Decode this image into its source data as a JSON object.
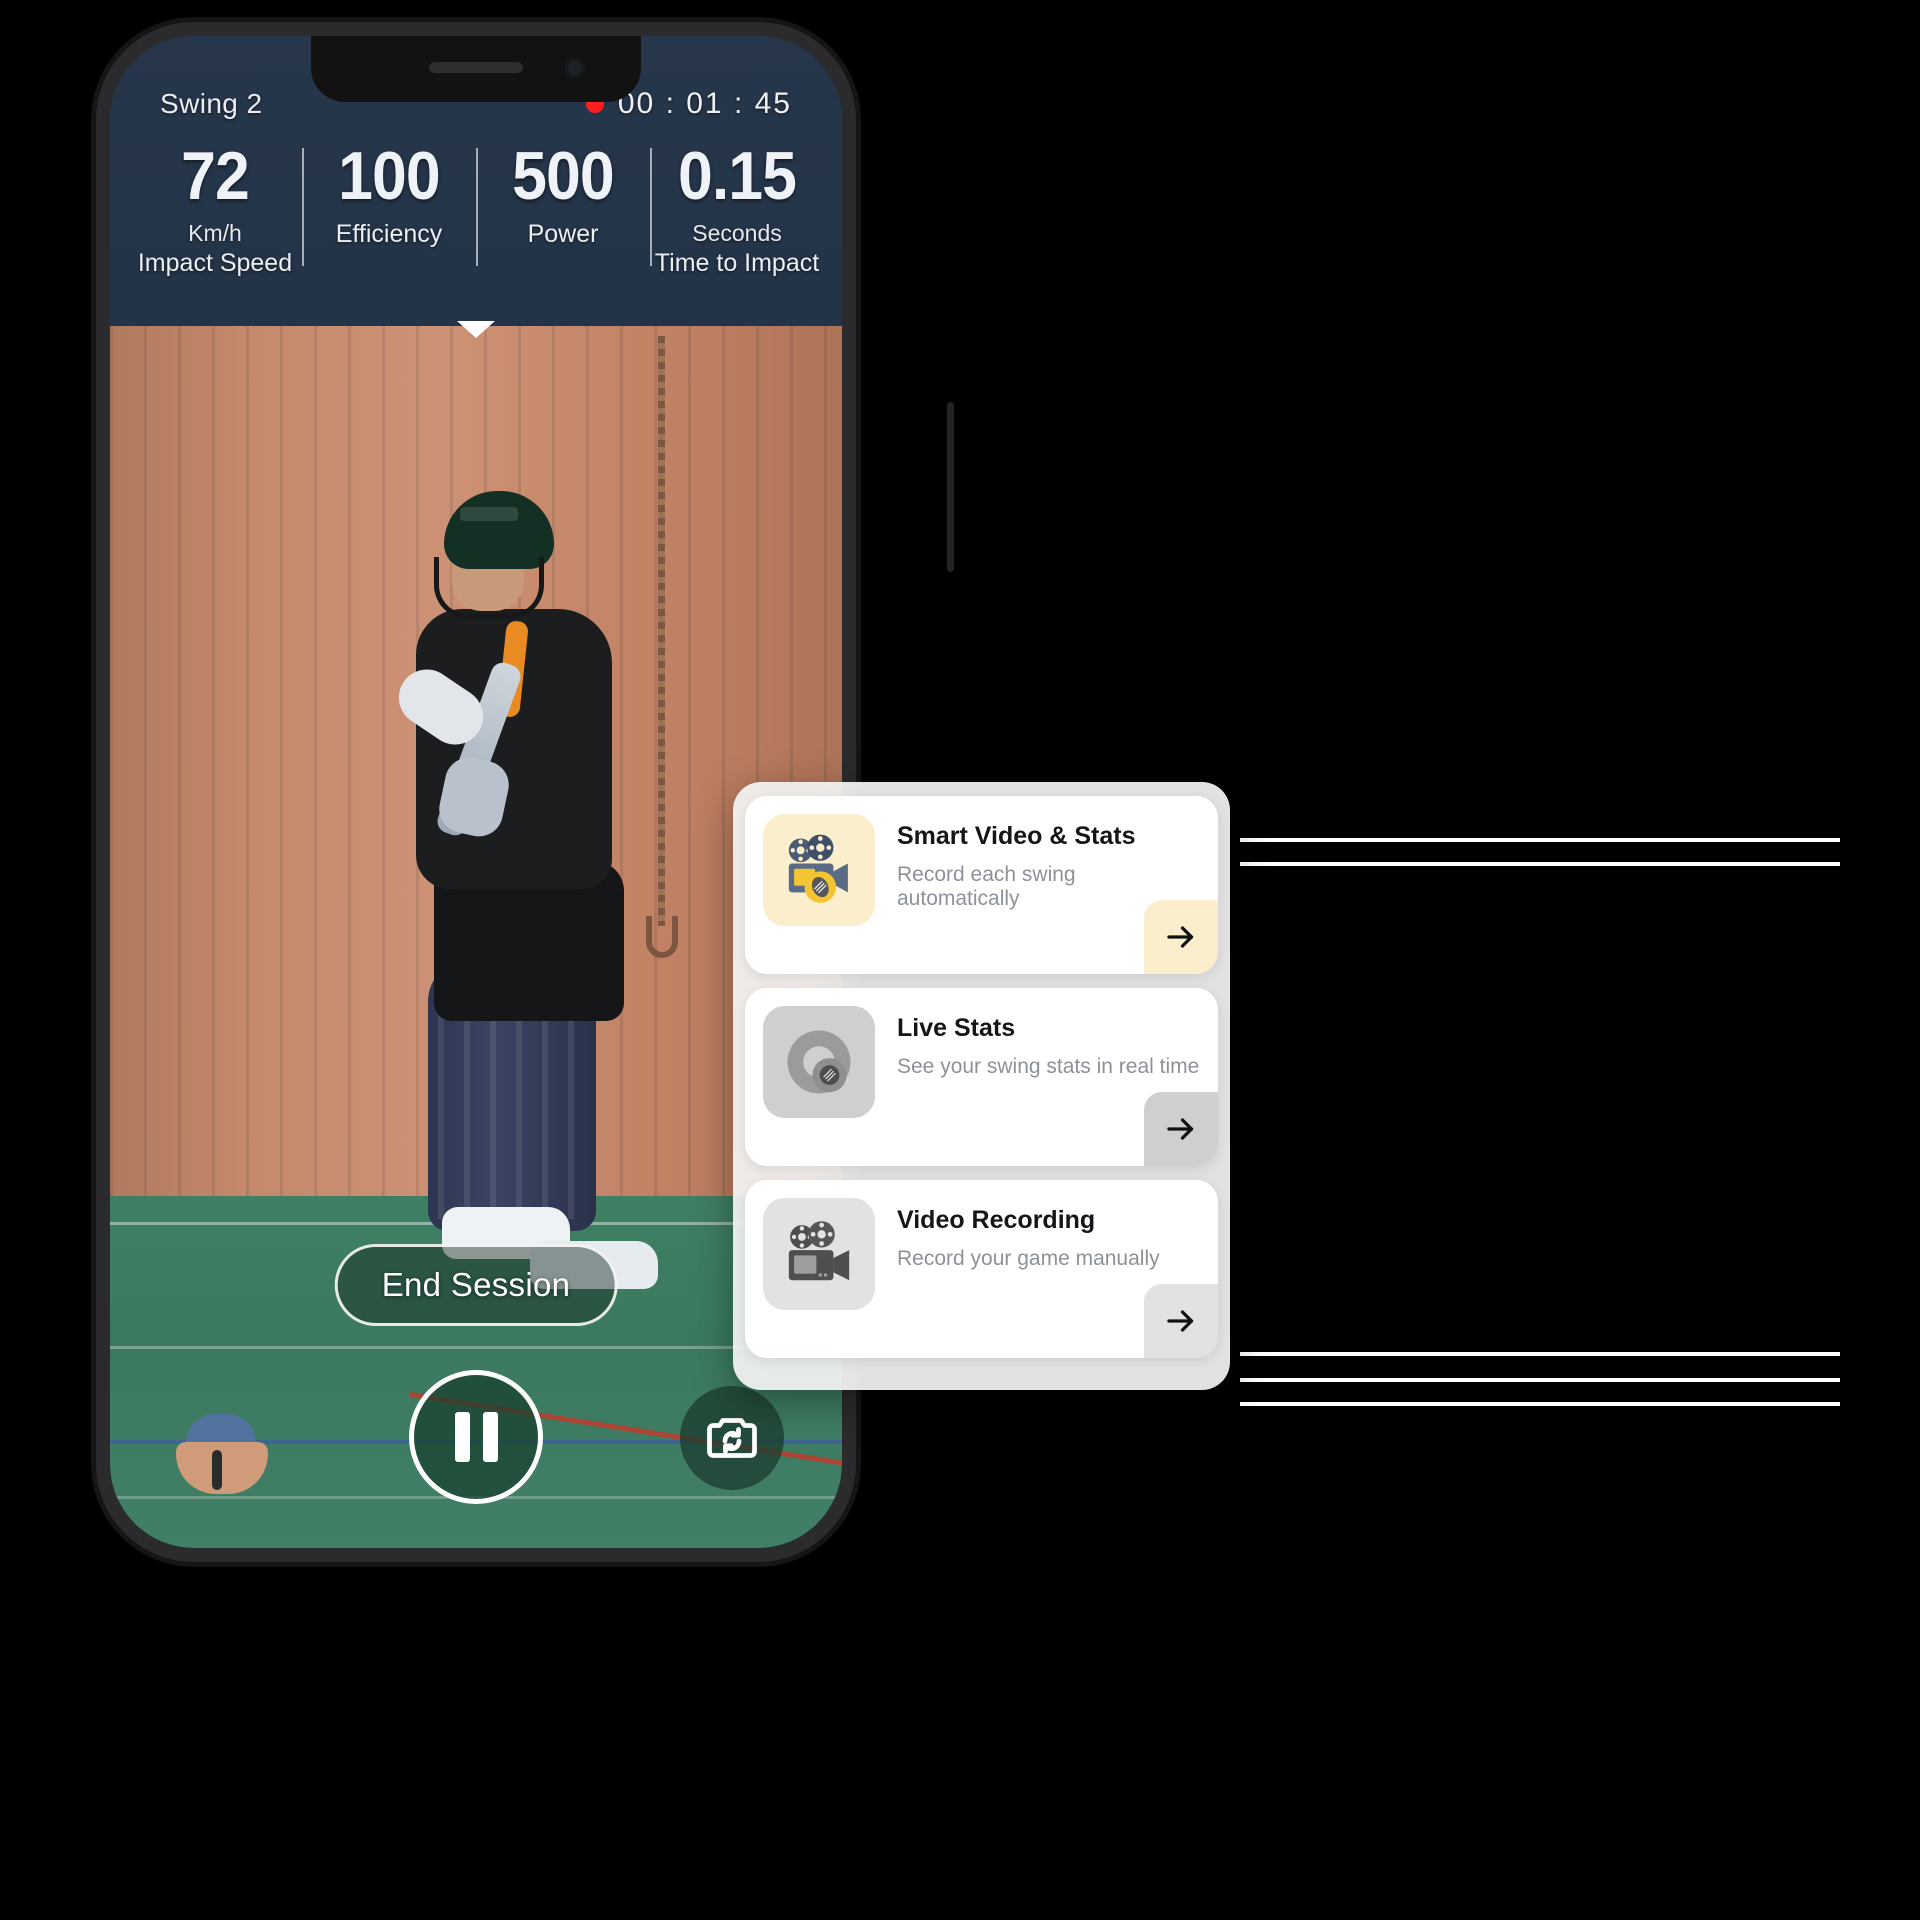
{
  "overlay": {
    "swing_label": "Swing  2",
    "timer": "00 : 01 : 45",
    "rec_indicator": "record-dot",
    "collapse_icon": "chevron-down-icon",
    "stats": [
      {
        "value": "72",
        "unit": "Km/h",
        "name": "Impact Speed"
      },
      {
        "value": "100",
        "unit": "",
        "name": "Efficiency"
      },
      {
        "value": "500",
        "unit": "",
        "name": "Power"
      },
      {
        "value": "0.15",
        "unit": "Seconds",
        "name": "Time to Impact"
      }
    ]
  },
  "controls": {
    "end_session_label": "End Session",
    "pause_icon": "pause-icon",
    "flip_camera_icon": "camera-flip-icon",
    "helmet_icon": "helmet-icon"
  },
  "cards_panel": {
    "cards": [
      {
        "title": "Smart Video & Stats",
        "subtitle": "Record each swing automatically",
        "icon": "movie-camera-ball-icon",
        "arrow": "arrow-right-icon",
        "theme": "warm"
      },
      {
        "title": "Live Stats",
        "subtitle": "See your swing stats in real time",
        "icon": "donut-chart-ball-icon",
        "arrow": "arrow-right-icon",
        "theme": "gray"
      },
      {
        "title": "Video Recording",
        "subtitle": "Record your game manually",
        "icon": "movie-camera-icon",
        "arrow": "arrow-right-icon",
        "theme": "gray2"
      }
    ]
  },
  "colors": {
    "overlay_bg": "#253549",
    "record_red": "#ff1f1f",
    "accent_yellow": "#f5c431",
    "card_warm": "#fbeecd",
    "title_dark": "#14161a",
    "subtitle_gray": "#8d9198"
  }
}
